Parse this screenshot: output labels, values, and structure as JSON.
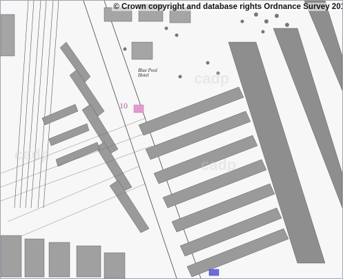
{
  "copyright": "© Crown copyright and database rights Ordnance Survey 201",
  "marker": {
    "label": "10",
    "color": "#e39ad0"
  },
  "secondary_marker": {
    "color": "#6c6ce0"
  },
  "street_label": "Blue Pool Hotel",
  "colors": {
    "paper": "#f7f7f7",
    "building": "#9a9a9a",
    "building_dark": "#7a7a7a",
    "line": "#444444"
  }
}
